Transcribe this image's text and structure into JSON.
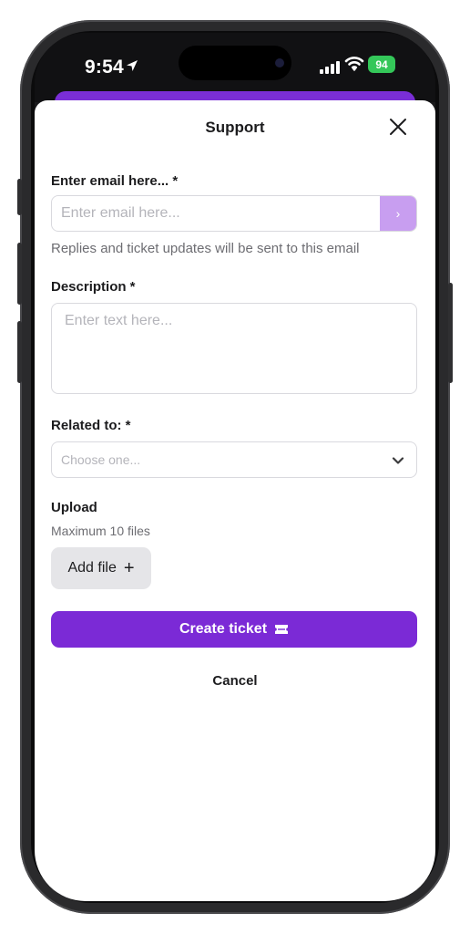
{
  "status_bar": {
    "time": "9:54",
    "battery": "94"
  },
  "modal": {
    "title": "Support",
    "email": {
      "label": "Enter email here... *",
      "placeholder": "Enter email here...",
      "submit_glyph": "›",
      "hint": "Replies and ticket updates will be sent to this email"
    },
    "description": {
      "label": "Description *",
      "placeholder": "Enter text here..."
    },
    "related": {
      "label": "Related to: *",
      "placeholder": "Choose one..."
    },
    "upload": {
      "label": "Upload",
      "hint": "Maximum 10 files",
      "add_button": "Add file",
      "add_glyph": "+"
    },
    "create_button": "Create ticket",
    "cancel_button": "Cancel"
  },
  "colors": {
    "accent": "#7b2ad6",
    "accent_light": "#c89ef0",
    "battery": "#34c759"
  },
  "icons": [
    "location-arrow-icon",
    "signal-icon",
    "wifi-icon",
    "close-icon",
    "chevron-right-icon",
    "chevron-down-icon",
    "plus-icon",
    "ticket-icon"
  ]
}
